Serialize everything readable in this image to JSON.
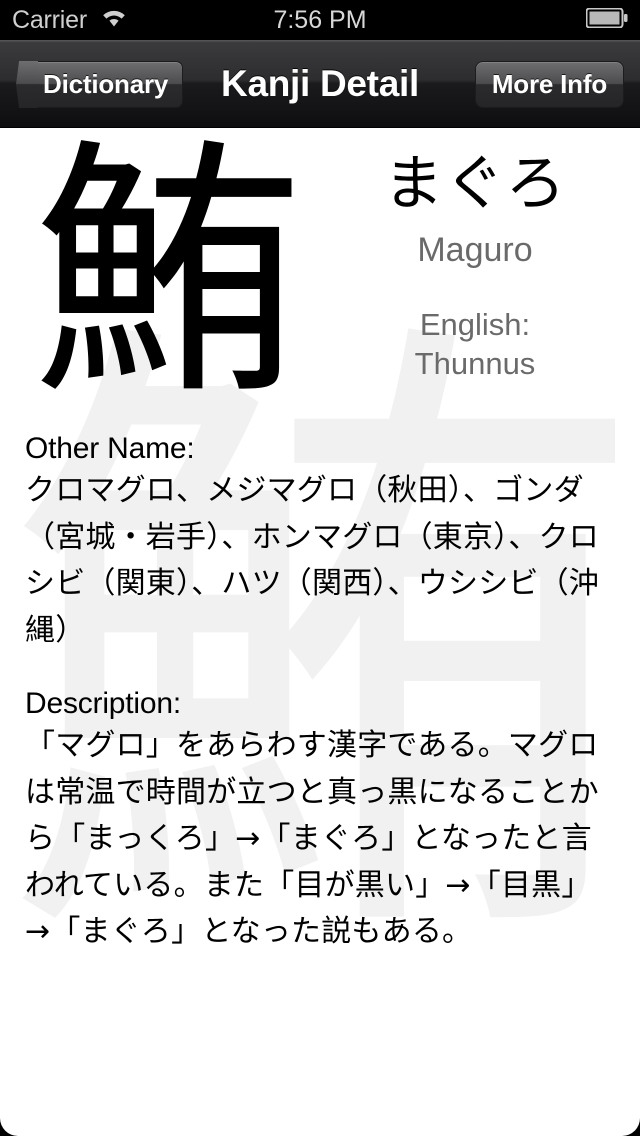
{
  "status_bar": {
    "carrier": "Carrier",
    "wifi_icon": "wifi-icon",
    "time": "7:56 PM",
    "battery_icon": "battery-full-icon"
  },
  "nav_bar": {
    "back_label": "Dictionary",
    "title": "Kanji Detail",
    "right_label": "More Info"
  },
  "entry": {
    "kanji": "鮪",
    "kana_reading": "まぐろ",
    "romaji": "Maguro",
    "english_label": "English:",
    "english_value": "Thunnus",
    "watermark_glyph": "鮪"
  },
  "sections": [
    {
      "heading": "Other Name:",
      "body": "クロマグロ、メジマグロ（秋田）、ゴンダ（宮城・岩手）、ホンマグロ（東京）、クロシビ（関東）、ハツ（関西）、ウシシビ（沖縄）"
    },
    {
      "heading": "Description:",
      "body": "「マグロ」をあらわす漢字である。マグロは常温で時間が立つと真っ黒になることから「まっくろ」→「まぐろ」となったと言われている。また「目が黒い」→「目黒」→「まぐろ」となった説もある。"
    }
  ],
  "colors": {
    "status_bar_bg": "#000000",
    "nav_bar_dark": "#1a1a1c",
    "content_bg": "#ffffff",
    "secondary_text": "#6a6a6a",
    "primary_text": "#000000",
    "watermark": "rgba(0,0,0,0.055)"
  }
}
